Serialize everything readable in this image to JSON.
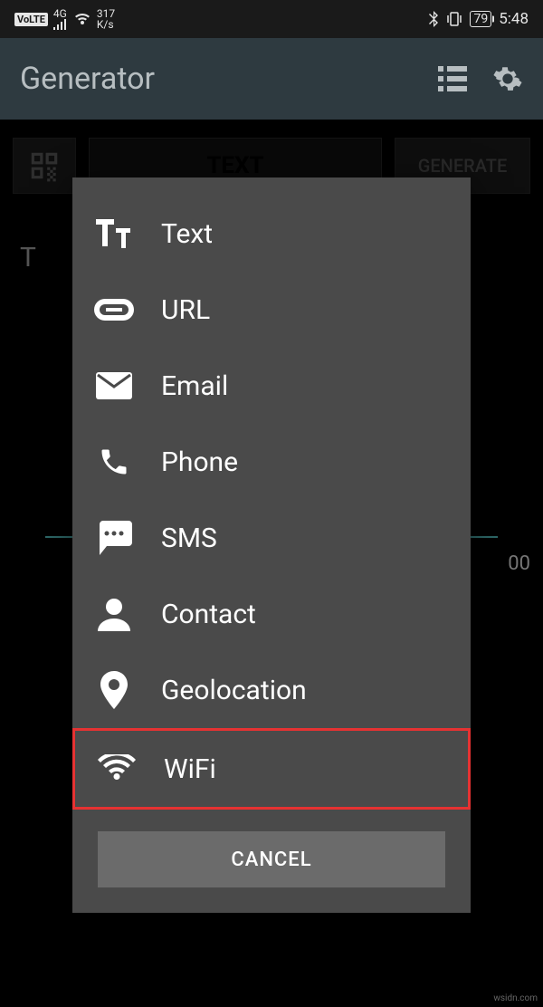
{
  "status": {
    "volte": "VoLTE",
    "network_type": "4G",
    "speed_value": "317",
    "speed_unit": "K/s",
    "battery": "79",
    "time": "5:48"
  },
  "appbar": {
    "title": "Generator"
  },
  "toolbar": {
    "type_label": "TEXT",
    "generate_label": "GENERATE"
  },
  "background": {
    "field_label_prefix": "T",
    "char_count": "00"
  },
  "menu": {
    "items": [
      {
        "label": "Text",
        "icon": "text"
      },
      {
        "label": "URL",
        "icon": "link"
      },
      {
        "label": "Email",
        "icon": "email"
      },
      {
        "label": "Phone",
        "icon": "phone"
      },
      {
        "label": "SMS",
        "icon": "sms"
      },
      {
        "label": "Contact",
        "icon": "contact"
      },
      {
        "label": "Geolocation",
        "icon": "location"
      },
      {
        "label": "WiFi",
        "icon": "wifi"
      }
    ],
    "cancel_label": "CANCEL"
  },
  "watermark": "wsidn.com"
}
